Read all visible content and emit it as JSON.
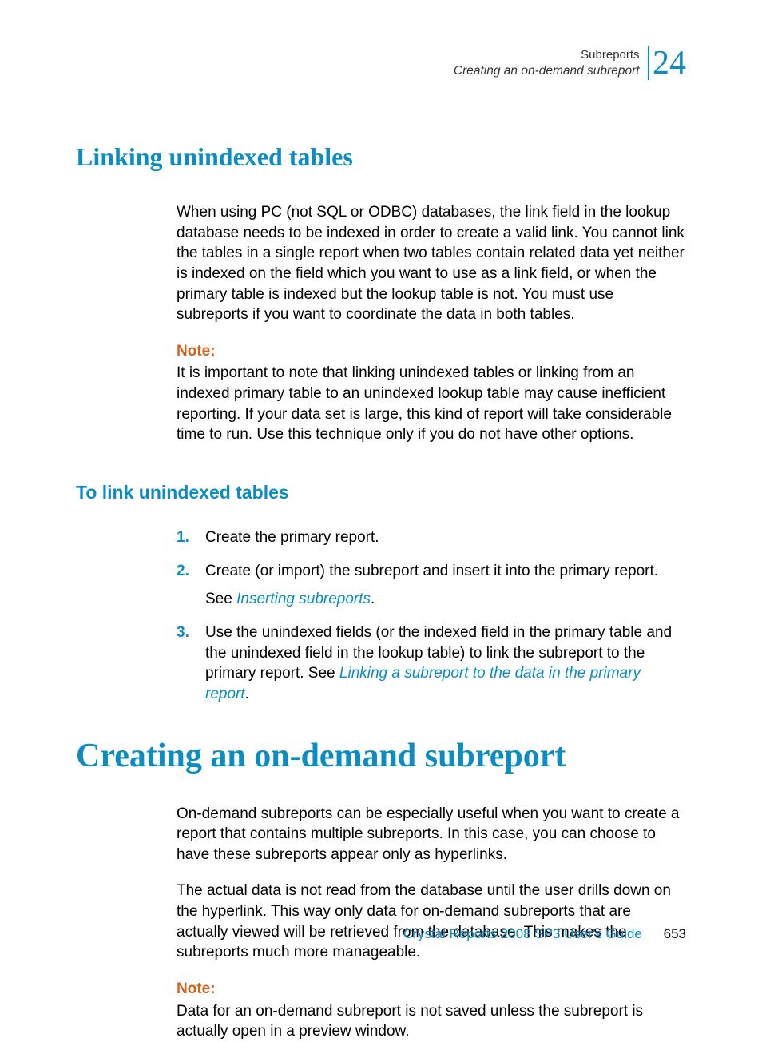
{
  "header": {
    "chapter_label": "Subreports",
    "section_label": "Creating an on-demand subreport",
    "chapter_number": "24"
  },
  "sections": {
    "h1_linking": "Linking unindexed tables",
    "linking_para": "When using PC (not SQL or ODBC) databases, the link field in the lookup database needs to be indexed in order to create a valid link. You cannot link the tables in a single report when two tables contain related data yet neither is indexed on the field which you want to use as a link field, or when the primary table is indexed but the lookup table is not. You must use subreports if you want to coordinate the data in both tables.",
    "note_label_1": "Note:",
    "linking_note": "It is important to note that linking unindexed tables or linking from an indexed primary table to an unindexed lookup table may cause inefficient reporting. If your data set is large, this kind of report will take considerable time to run. Use this technique only if you do not have other options.",
    "h2_to_link": "To link unindexed tables",
    "steps": {
      "s1": "Create the primary report.",
      "s2": "Create (or import) the subreport and insert it into the primary report.",
      "s2_see_prefix": "See ",
      "s2_link": "Inserting subreports",
      "s2_see_suffix": ".",
      "s3_prefix": "Use the unindexed fields (or the indexed field in the primary table and the unindexed field in the lookup table) to link the subreport to the primary report. See ",
      "s3_link": "Linking a subreport to the data in the primary report",
      "s3_suffix": "."
    },
    "h1_creating": "Creating an on-demand subreport",
    "creating_para1": "On-demand subreports can be especially useful when you want to create a report that contains multiple subreports. In this case, you can choose to have these subreports appear only as hyperlinks.",
    "creating_para2": "The actual data is not read from the database until the user drills down on the hyperlink. This way only data for on-demand subreports that are actually viewed will be retrieved from the database. This makes the subreports much more manageable.",
    "note_label_2": "Note:",
    "creating_note": "Data for an on-demand subreport is not saved unless the subreport is actually open in a preview window."
  },
  "footer": {
    "doc_title": "Crystal Reports 2008 SP3 User's Guide",
    "page_number": "653"
  }
}
